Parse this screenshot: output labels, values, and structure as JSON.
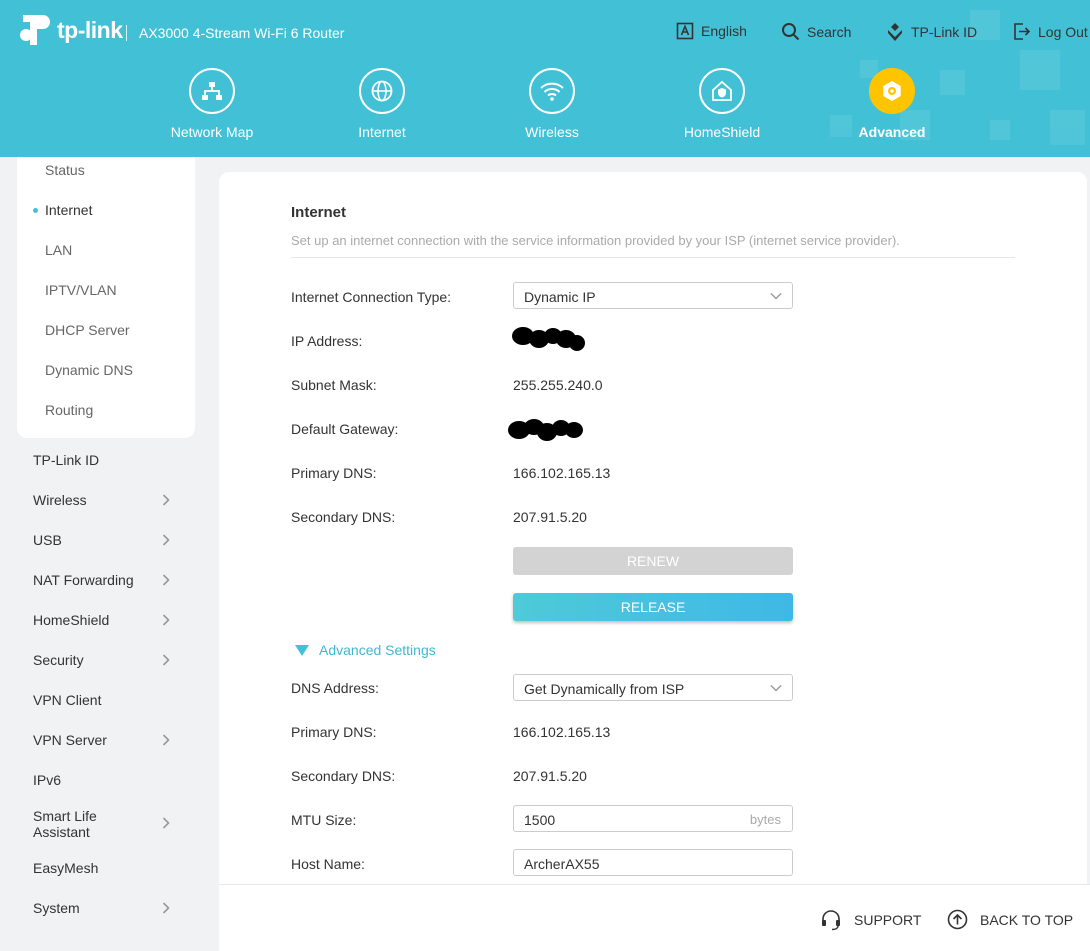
{
  "header": {
    "logo_text": "tp-link",
    "model": "AX3000 4-Stream Wi-Fi 6 Router",
    "top_links": [
      {
        "label": "English",
        "icon": "language-icon"
      },
      {
        "label": "Search",
        "icon": "search-icon"
      },
      {
        "label": "TP-Link ID",
        "icon": "tplink-id-icon"
      },
      {
        "label": "Log Out",
        "icon": "logout-icon"
      }
    ],
    "nav": [
      {
        "label": "Network Map",
        "icon": "network-map-icon"
      },
      {
        "label": "Internet",
        "icon": "globe-icon"
      },
      {
        "label": "Wireless",
        "icon": "wifi-icon"
      },
      {
        "label": "HomeShield",
        "icon": "homeshield-icon"
      },
      {
        "label": "Advanced",
        "icon": "gear-icon",
        "active": true
      }
    ]
  },
  "sidebar": {
    "sub_items": [
      "Status",
      "Internet",
      "LAN",
      "IPTV/VLAN",
      "DHCP Server",
      "Dynamic DNS",
      "Routing"
    ],
    "active_sub": "Internet",
    "items": [
      {
        "label": "TP-Link ID",
        "expandable": false
      },
      {
        "label": "Wireless",
        "expandable": true
      },
      {
        "label": "USB",
        "expandable": true
      },
      {
        "label": "NAT Forwarding",
        "expandable": true
      },
      {
        "label": "HomeShield",
        "expandable": true
      },
      {
        "label": "Security",
        "expandable": true
      },
      {
        "label": "VPN Client",
        "expandable": false
      },
      {
        "label": "VPN Server",
        "expandable": true
      },
      {
        "label": "IPv6",
        "expandable": false
      },
      {
        "label": "Smart Life\nAssistant",
        "expandable": true
      },
      {
        "label": "EasyMesh",
        "expandable": false
      },
      {
        "label": "System",
        "expandable": true
      }
    ]
  },
  "main": {
    "title": "Internet",
    "description": "Set up an internet connection with the service information provided by your ISP (internet service provider).",
    "connection_type_label": "Internet Connection Type:",
    "connection_type_value": "Dynamic IP",
    "ip_label": "IP Address:",
    "subnet_label": "Subnet Mask:",
    "subnet_value": "255.255.240.0",
    "gateway_label": "Default Gateway:",
    "primary_dns_label": "Primary DNS:",
    "primary_dns_value": "166.102.165.13",
    "secondary_dns_label": "Secondary DNS:",
    "secondary_dns_value": "207.91.5.20",
    "renew_label": "RENEW",
    "release_label": "RELEASE",
    "advanced_label": "Advanced Settings",
    "dns_address_label": "DNS Address:",
    "dns_address_value": "Get Dynamically from ISP",
    "adv_primary_dns_label": "Primary DNS:",
    "adv_primary_dns_value": "166.102.165.13",
    "adv_secondary_dns_label": "Secondary DNS:",
    "adv_secondary_dns_value": "207.91.5.20",
    "mtu_label": "MTU Size:",
    "mtu_value": "1500",
    "mtu_unit": "bytes",
    "host_label": "Host Name:",
    "host_value": "ArcherAX55"
  },
  "footer": {
    "support_label": "SUPPORT",
    "back_to_top_label": "BACK TO TOP"
  },
  "colors": {
    "header": "#42c1d6",
    "accent": "#42b8d0",
    "active_nav": "#ffc400"
  }
}
